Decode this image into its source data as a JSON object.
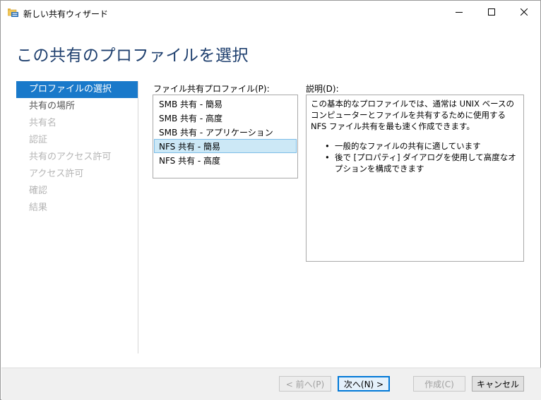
{
  "window": {
    "title": "新しい共有ウィザード",
    "icons": {
      "app": "share-folder-icon",
      "minimize": "minimize-icon",
      "maximize": "maximize-icon",
      "close": "close-icon"
    }
  },
  "page": {
    "title": "この共有のプロファイルを選択"
  },
  "nav": {
    "items": [
      {
        "label": "プロファイルの選択",
        "state": "selected"
      },
      {
        "label": "共有の場所",
        "state": "enabled"
      },
      {
        "label": "共有名",
        "state": "disabled"
      },
      {
        "label": "認証",
        "state": "disabled"
      },
      {
        "label": "共有のアクセス許可",
        "state": "disabled"
      },
      {
        "label": "アクセス許可",
        "state": "disabled"
      },
      {
        "label": "確認",
        "state": "disabled"
      },
      {
        "label": "結果",
        "state": "disabled"
      }
    ]
  },
  "profiles": {
    "label": "ファイル共有プロファイル(P):",
    "items": [
      {
        "label": "SMB 共有 - 簡易"
      },
      {
        "label": "SMB 共有 - 高度"
      },
      {
        "label": "SMB 共有 - アプリケーション"
      },
      {
        "label": "NFS 共有 - 簡易",
        "selected": true
      },
      {
        "label": "NFS 共有 - 高度"
      }
    ]
  },
  "description": {
    "label": "説明(D):",
    "text": "この基本的なプロファイルでは、通常は UNIX ベースのコンピューターとファイルを共有するために使用する NFS ファイル共有を最も速く作成できます。",
    "bullets": [
      "一般的なファイルの共有に適しています",
      "後で [プロパティ] ダイアログを使用して高度なオプションを構成できます"
    ]
  },
  "footer": {
    "prev_label": "< 前へ(P)",
    "next_label": "次へ(N) >",
    "create_label": "作成(C)",
    "cancel_label": "キャンセル"
  },
  "colors": {
    "title": "#1e3f6e",
    "nav_selected_bg": "#1979ca",
    "list_selected_bg": "#cce8f6",
    "primary_button_border": "#0078d7"
  }
}
